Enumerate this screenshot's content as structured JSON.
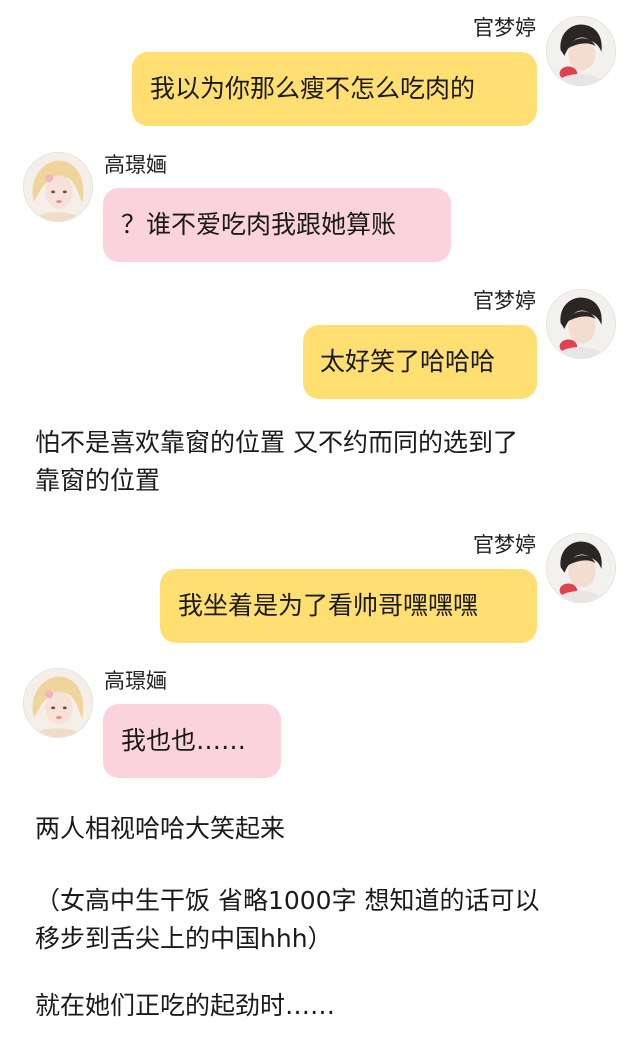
{
  "users": {
    "guan": {
      "name": "官梦婷"
    },
    "gao": {
      "name": "高璟婳"
    }
  },
  "messages": [
    {
      "sender": "官梦婷",
      "text": "我以为你那么瘦不怎么吃肉的"
    },
    {
      "sender": "高璟婳",
      "text": "？谁不爱吃肉我跟她算账"
    },
    {
      "sender": "官梦婷",
      "text": "太好笑了哈哈哈"
    },
    {
      "sender": "官梦婷",
      "text": "我坐着是为了看帅哥嘿嘿嘿"
    },
    {
      "sender": "高璟婳",
      "text": "我也也……"
    }
  ],
  "narration": [
    {
      "lines": [
        "怕不是喜欢靠窗的位置 又不约而同的选到了",
        "靠窗的位置"
      ]
    },
    {
      "lines": [
        "两人相视哈哈大笑起来"
      ]
    },
    {
      "lines": [
        "（女高中生干饭 省略1000字 想知道的话可以",
        "移步到舌尖上的中国hhh）"
      ]
    },
    {
      "lines": [
        "就在她们正吃的起劲时……"
      ]
    }
  ],
  "colors": {
    "bubble_outgoing": "#ffdf72",
    "bubble_incoming": "#fbd3dc",
    "background": "#ffffff",
    "text": "#1a1a1a"
  }
}
